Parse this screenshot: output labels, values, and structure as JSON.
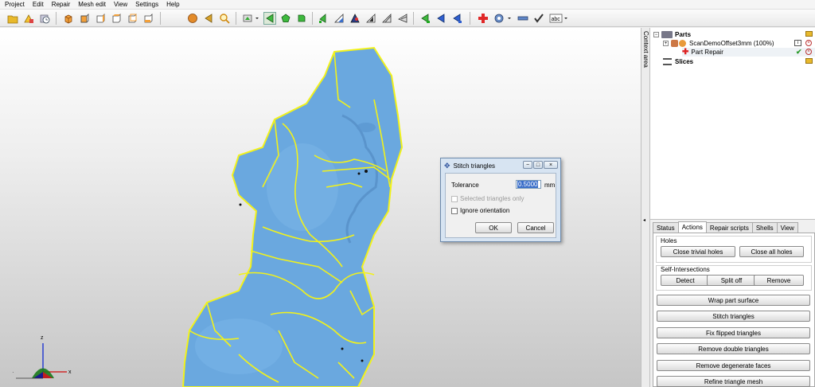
{
  "menu": [
    "Project",
    "Edit",
    "Repair",
    "Mesh edit",
    "View",
    "Settings",
    "Help"
  ],
  "toolbar_icons": [
    "open-icon",
    "parts-icon",
    "clock-icon",
    "cube-icon",
    "cube-front-icon",
    "cube-side-icon",
    "cube-top-icon",
    "cube-back-icon",
    "cube-iso-icon",
    "sphere-icon",
    "arrow-left-icon",
    "zoom-icon",
    "select-dropdown-icon",
    "triangle-select-icon",
    "pentagon-icon",
    "square-icon",
    "mark-triangle-icon",
    "surface-a-icon",
    "surface-b-icon",
    "surface-c-icon",
    "surface-d-icon",
    "green-arrow-icon",
    "blue-arrow-icon",
    "blue-arrow-left-icon",
    "red-cross-icon",
    "settings-dropdown-icon",
    "minus-icon",
    "checkmark-icon",
    "abc-dropdown-icon"
  ],
  "context_area_label": "Context area",
  "tree": {
    "parts_label": "Parts",
    "part_name": "ScanDemoOffset3mm (100%)",
    "repair_label": "Part Repair",
    "slices_label": "Slices"
  },
  "tabs": [
    "Status",
    "Actions",
    "Repair scripts",
    "Shells",
    "View"
  ],
  "active_tab": "Actions",
  "actions": {
    "holes_label": "Holes",
    "close_trivial": "Close trivial holes",
    "close_all": "Close all holes",
    "self_label": "Self-Intersections",
    "detect": "Detect",
    "split_off": "Split off",
    "remove": "Remove",
    "wrap": "Wrap part surface",
    "stitch": "Stitch triangles",
    "fix_flipped": "Fix flipped triangles",
    "remove_double": "Remove double triangles",
    "remove_degenerate": "Remove degenerate faces",
    "refine": "Refine triangle mesh"
  },
  "dialog": {
    "title": "Stitch triangles",
    "tolerance_label": "Tolerance",
    "tolerance_value": "0.5000",
    "unit": "mm",
    "selected_only": "Selected triangles only",
    "ignore_orientation": "Ignore orientation",
    "ok": "OK",
    "cancel": "Cancel"
  },
  "axes": {
    "z": "z",
    "x": "x"
  },
  "colors": {
    "mesh": "#6aa8df",
    "edges": "#f2f21a",
    "dialog_frame": "#d7e4f2"
  }
}
